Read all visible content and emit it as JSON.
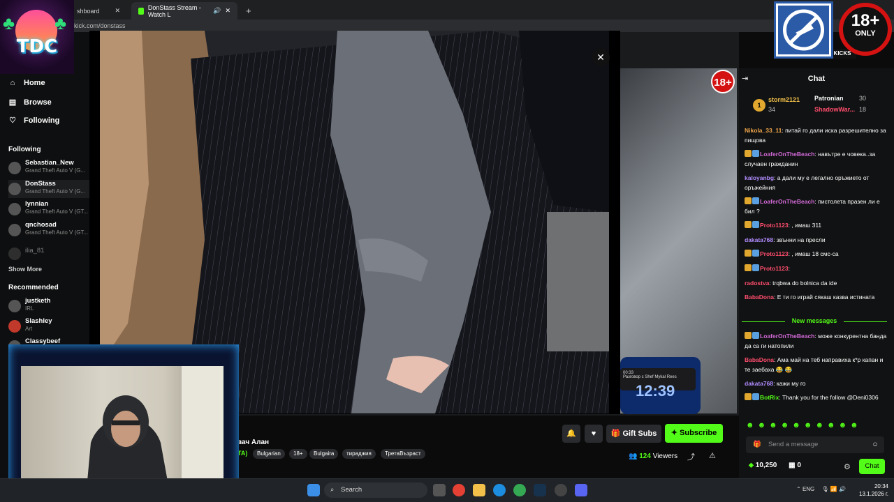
{
  "browser": {
    "tab1_label": "shboard",
    "tab2_label": "DonStass Stream - Watch L",
    "new_tab_glyph": "+",
    "url": "kick.com/donstass"
  },
  "logo": {
    "text": "TDC"
  },
  "sidebar": {
    "nav": [
      {
        "label": "Home",
        "icon": "home-icon"
      },
      {
        "label": "Browse",
        "icon": "browse-icon"
      },
      {
        "label": "Following",
        "icon": "heart-icon"
      }
    ],
    "following_title": "Following",
    "following": [
      {
        "name": "Sebastian_New",
        "game": "Grand Theft Auto V (G..."
      },
      {
        "name": "DonStass",
        "game": "Grand Theft Auto V (G..."
      },
      {
        "name": "lynnian",
        "game": "Grand Theft Auto V (GT..."
      },
      {
        "name": "qnchosad",
        "game": "Grand Theft Auto V (GT..."
      },
      {
        "name": "ilia_81",
        "game": ""
      }
    ],
    "show_more": "Show More",
    "recommended_title": "Recommended",
    "recommended": [
      {
        "name": "justketh",
        "game": "IRL"
      },
      {
        "name": "Slashley",
        "game": "Art"
      },
      {
        "name": "Classybeef",
        "game": ""
      }
    ]
  },
  "stream": {
    "title_fragment": "вач Алан",
    "tag_prefix": "TA)",
    "tags": [
      "Bulgarian",
      "18+",
      "Bulgaira",
      "тираджия",
      "ТретаВъзраст"
    ],
    "gift_label": "Gift Subs",
    "subscribe_label": "Subscribe",
    "viewers_count": "124",
    "viewers_label": "Viewers"
  },
  "phone": {
    "time_small": "00:33",
    "notice": "Разговор с Shef Mykal Rees",
    "time_big": "12:39"
  },
  "overlay": {
    "badge_18": "18+",
    "badge_only": "ONLY",
    "small_18": "18+",
    "kicks_label": "KICKS"
  },
  "lightbox": {
    "close_glyph": "✕"
  },
  "chat": {
    "title": "Chat",
    "pinned": [
      {
        "rank": "1",
        "name": "storm2121",
        "count": "34"
      },
      {
        "name": "Patronian",
        "count": "30"
      },
      {
        "name": "ShadowWar...",
        "count": "18"
      }
    ],
    "messages": [
      {
        "user": "Nikola_33_11",
        "color": "#f0a64b",
        "text": ": питай го дали иска разрешително за пищова"
      },
      {
        "user": "LoaferOnTheBeach",
        "color": "#d36bd8",
        "text": ": навътре е човека..за случаен гражданин"
      },
      {
        "user": "kaloyanbg",
        "color": "#b18cff",
        "text": ": а дали му е легално оръжието от оръжейния"
      },
      {
        "user": "LoaferOnTheBeach",
        "color": "#d36bd8",
        "text": ": пистолета празен ли е бил ?"
      },
      {
        "user": "Proto1123",
        "color": "#ff4d6d",
        "text": ": , имаш 311"
      },
      {
        "user": "dakata768",
        "color": "#b18cff",
        "text": ": звънни на пресли"
      },
      {
        "user": "Proto1123",
        "color": "#ff4d6d",
        "text": ": , имаш 18 смс-са"
      },
      {
        "user": "Proto1123",
        "color": "#ff4d6d",
        "text": ":"
      },
      {
        "user": "radostva",
        "color": "#ff4d6d",
        "text": ": trqbwa do bolnica da ide"
      },
      {
        "user": "BabaDona",
        "color": "#ff4d6d",
        "text": ": Е ти го играй сякаш казва истината"
      },
      {
        "user": "LoaferOnTheBeach",
        "color": "#d36bd8",
        "text": ": може конкурентна банда да са ги натопили"
      },
      {
        "user": "BabaDona",
        "color": "#ff4d6d",
        "text": ": Ама май на теб направиха к*р капан и те заебаха 😂 😂"
      },
      {
        "user": "dakata768",
        "color": "#b18cff",
        "text": ": кажи му го"
      },
      {
        "user": "BotRix",
        "color": "#53fc18",
        "text": ": Thank you for the follow @Deni0306"
      }
    ],
    "new_messages": "New messages",
    "input_placeholder": "Send a message",
    "points": "10,250",
    "drops": "0",
    "send_label": "Chat"
  },
  "taskbar": {
    "search_label": "Search",
    "lang": "ENG",
    "time": "20:34",
    "date": "13.1.2026 г."
  },
  "colors": {
    "accent": "#53fc18",
    "danger": "#d41212"
  }
}
